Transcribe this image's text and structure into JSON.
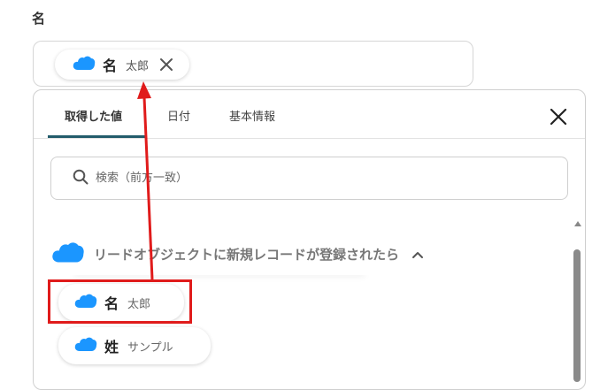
{
  "field": {
    "label": "名",
    "selected_chip": {
      "name": "名",
      "value": "太郎"
    }
  },
  "panel": {
    "tabs": [
      {
        "label": "取得した値",
        "active": true
      },
      {
        "label": "日付",
        "active": false
      },
      {
        "label": "基本情報",
        "active": false
      }
    ],
    "search": {
      "placeholder": "検索（前方一致）"
    },
    "group": {
      "title": "リードオブジェクトに新規レコードが登録されたら",
      "expanded": true
    },
    "fields": [
      {
        "name": "名",
        "value": "太郎"
      },
      {
        "name": "姓",
        "value": "サンプル"
      }
    ]
  },
  "colors": {
    "accent_tab": "#235c6b",
    "salesforce_blue": "#1b96ff",
    "annotation_red": "#e01b1b"
  },
  "icons": {
    "salesforce": "salesforce-cloud-icon",
    "remove": "close-icon",
    "panel_close": "close-icon",
    "search": "search-icon",
    "collapse": "chevron-up-icon"
  }
}
